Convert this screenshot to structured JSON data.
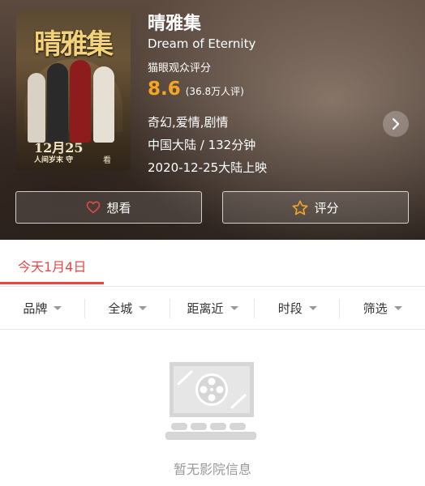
{
  "movie": {
    "title_cn": "晴雅集",
    "title_en": "Dream of Eternity",
    "rating_label": "猫眼观众评分",
    "rating_score": "8.6",
    "rating_count": "(36.8万人评)",
    "genres": "奇幻,爱情,剧情",
    "country_duration": "中国大陆 / 132分钟",
    "release": "2020-12-25大陆上映"
  },
  "poster": {
    "title_art": "晴雅集",
    "date_art": "12月25",
    "sub_art": "人间岁末 守",
    "watch_art": "看"
  },
  "actions": {
    "want_label": "想看",
    "rate_label": "评分"
  },
  "date_tab": {
    "label": "今天1月4日"
  },
  "filters": [
    {
      "label": "品牌"
    },
    {
      "label": "全城"
    },
    {
      "label": "距离近"
    },
    {
      "label": "时段"
    },
    {
      "label": "筛选"
    }
  ],
  "empty_state": {
    "message": "暂无影院信息",
    "icon": "cinema-placeholder-icon"
  },
  "colors": {
    "accent": "#e54847",
    "rating": "#f5a623"
  }
}
